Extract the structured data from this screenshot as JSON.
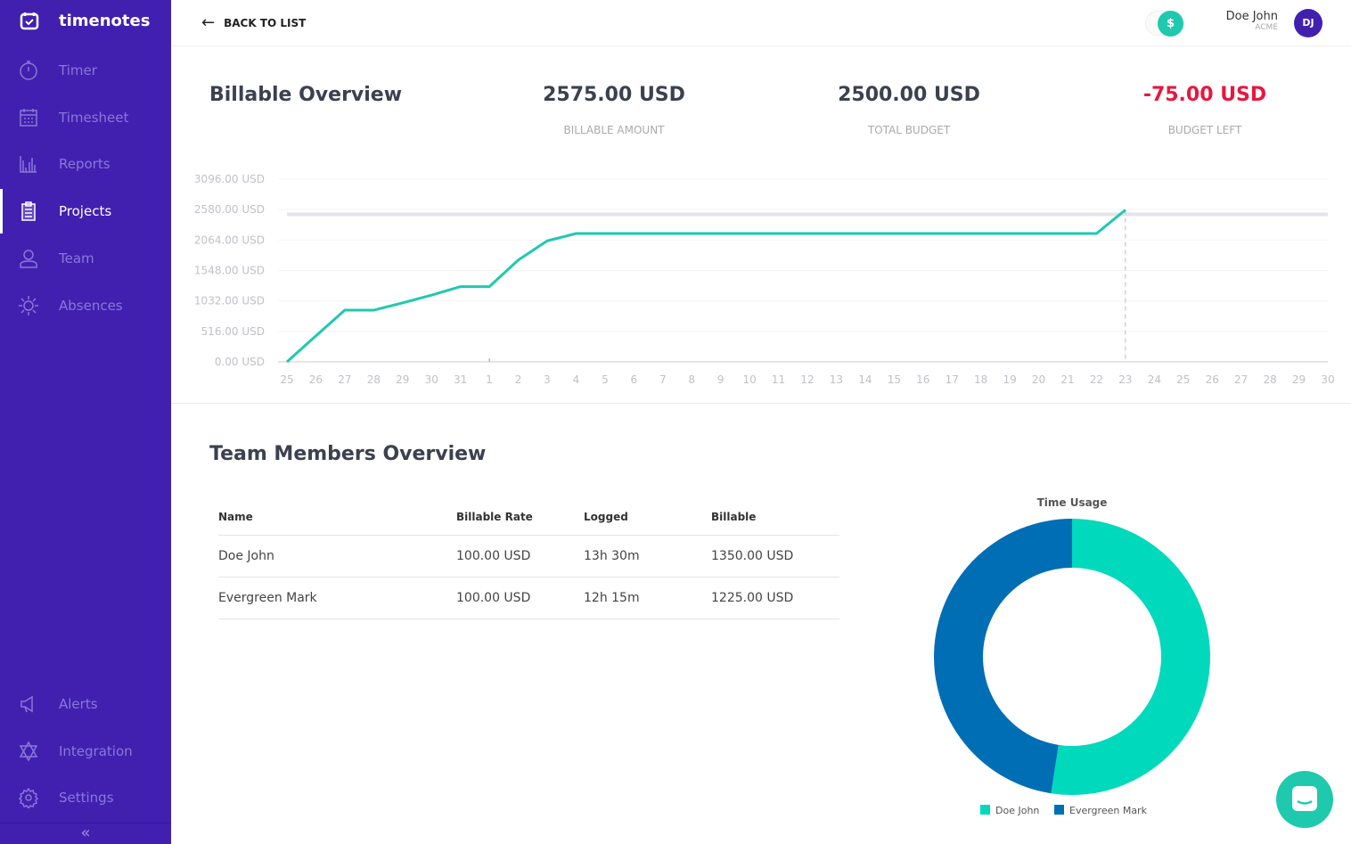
{
  "brand": "timenotes",
  "nav": [
    {
      "label": "Timer",
      "icon": "stopwatch-icon"
    },
    {
      "label": "Timesheet",
      "icon": "calendar-icon"
    },
    {
      "label": "Reports",
      "icon": "bar-chart-icon"
    },
    {
      "label": "Projects",
      "icon": "clipboard-icon",
      "active": true
    },
    {
      "label": "Team",
      "icon": "user-icon"
    },
    {
      "label": "Absences",
      "icon": "sun-icon"
    }
  ],
  "nav_bottom": [
    {
      "label": "Alerts",
      "icon": "megaphone-icon"
    },
    {
      "label": "Integration",
      "icon": "integration-icon"
    },
    {
      "label": "Settings",
      "icon": "gear-icon"
    }
  ],
  "collapse": "«",
  "topbar": {
    "back": "BACK TO LIST",
    "toggle_symbol": "$",
    "user_name": "Doe John",
    "org": "ACME",
    "initials": "DJ"
  },
  "billable": {
    "title": "Billable Overview",
    "stats": [
      {
        "value": "2575.00 USD",
        "label": "BILLABLE AMOUNT"
      },
      {
        "value": "2500.00 USD",
        "label": "TOTAL BUDGET"
      },
      {
        "value": "-75.00 USD",
        "label": "BUDGET LEFT",
        "color": "#e8173f"
      }
    ]
  },
  "chart_data": [
    {
      "type": "line",
      "title": "Billable Overview",
      "x": [
        "25",
        "26",
        "27",
        "28",
        "29",
        "30",
        "31",
        "1",
        "2",
        "3",
        "4",
        "5",
        "6",
        "7",
        "8",
        "9",
        "10",
        "11",
        "12",
        "13",
        "14",
        "15",
        "16",
        "17",
        "18",
        "19",
        "20",
        "21",
        "22",
        "23",
        "24",
        "25",
        "26",
        "27",
        "28",
        "29",
        "30"
      ],
      "y_ticks": [
        "0.00 USD",
        "516.00 USD",
        "1032.00 USD",
        "1548.00 USD",
        "2064.00 USD",
        "2580.00 USD",
        "3096.00 USD"
      ],
      "ylim": [
        0,
        3096
      ],
      "budget": 2500,
      "marker_index": 29,
      "series": [
        {
          "name": "Billable",
          "color": "#1fc9ae",
          "values": [
            0,
            440,
            875,
            875,
            1000,
            1130,
            1275,
            1275,
            1725,
            2050,
            2175,
            2175,
            2175,
            2175,
            2175,
            2175,
            2175,
            2175,
            2175,
            2175,
            2175,
            2175,
            2175,
            2175,
            2175,
            2175,
            2175,
            2175,
            2175,
            2575
          ]
        }
      ]
    },
    {
      "type": "pie",
      "title": "Time Usage",
      "legend": "bottom",
      "slices": [
        {
          "name": "Doe John",
          "value": 1350,
          "color": "#00d9bc"
        },
        {
          "name": "Evergreen Mark",
          "value": 1225,
          "color": "#006eb5"
        }
      ]
    }
  ],
  "team": {
    "title": "Team Members Overview",
    "headers": [
      "Name",
      "Billable Rate",
      "Logged",
      "Billable"
    ],
    "rows": [
      [
        "Doe John",
        "100.00 USD",
        "13h 30m",
        "1350.00 USD"
      ],
      [
        "Evergreen Mark",
        "100.00 USD",
        "12h 15m",
        "1225.00 USD"
      ]
    ]
  }
}
